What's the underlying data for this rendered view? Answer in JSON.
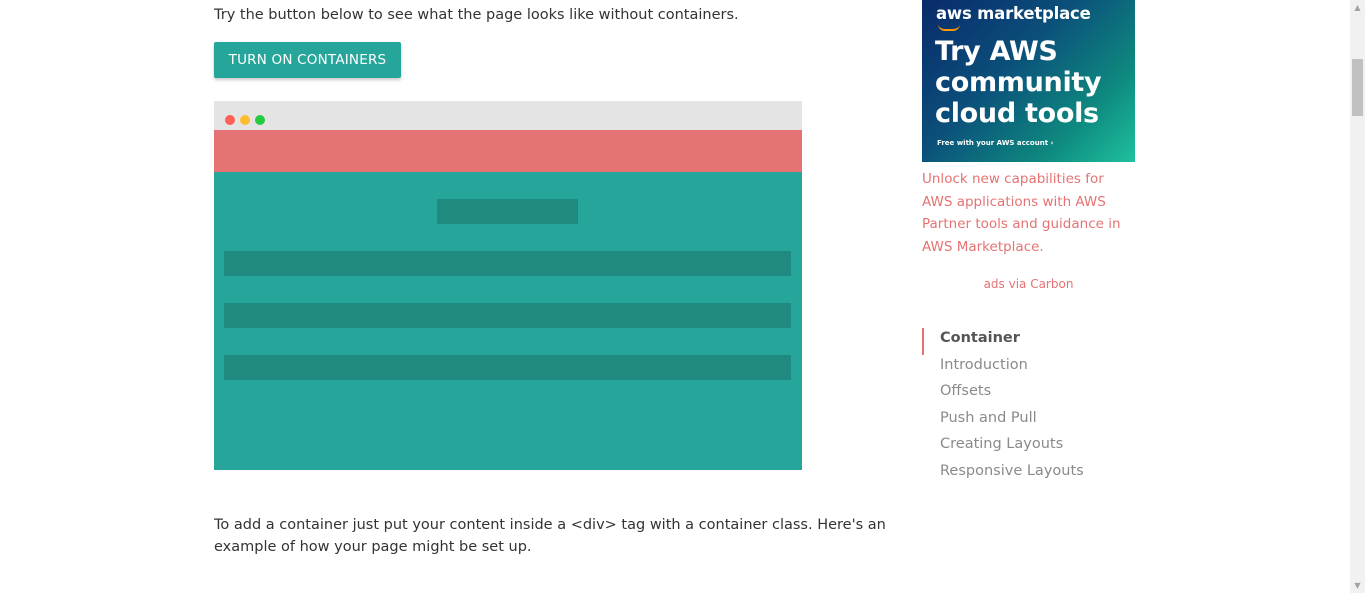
{
  "main": {
    "intro_text": "Try the button below to see what the page looks like without containers.",
    "toggle_button_label": "TURN ON CONTAINERS",
    "description_text": "To add a container just put your content inside a <div> tag with a container class. Here's an example of how your page might be set up."
  },
  "ad": {
    "brand": "aws marketplace",
    "headline": "Try AWS community cloud tools",
    "small_print": "Free with your AWS account ›",
    "text": "Unlock new capabilities for AWS applications with AWS Partner tools and guidance in AWS Marketplace.",
    "via": "ads via Carbon"
  },
  "toc": {
    "items": [
      {
        "label": "Container"
      },
      {
        "label": "Introduction"
      },
      {
        "label": "Offsets"
      },
      {
        "label": "Push and Pull"
      },
      {
        "label": "Creating Layouts"
      },
      {
        "label": "Responsive Layouts"
      }
    ]
  },
  "scrollbar": {
    "up_icon": "▲",
    "down_icon": "▼"
  },
  "colors": {
    "accent": "#26a69a",
    "accent_dark": "#208a81",
    "header_red": "#e57373",
    "link": "#e57373"
  }
}
